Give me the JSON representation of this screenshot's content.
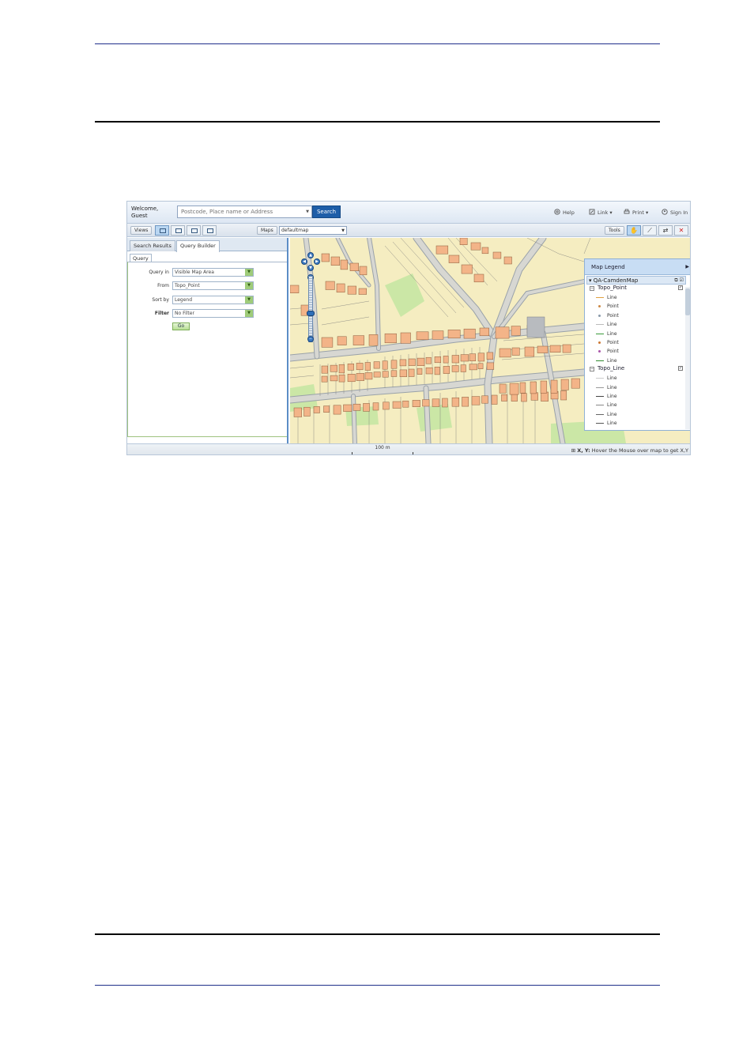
{
  "header": {
    "welcome_line1": "Welcome,",
    "welcome_line2": "Guest",
    "search_placeholder": "Postcode, Place name or Address",
    "search_button": "Search",
    "links": {
      "help": "Help",
      "link": "Link",
      "print": "Print",
      "sign_in": "Sign In"
    }
  },
  "toolbar": {
    "views_label": "Views",
    "maps_label": "Maps",
    "selected_map": "defaultmap",
    "tools_label": "Tools"
  },
  "panel": {
    "tabs": [
      "Search Results",
      "Query Builder"
    ],
    "active_tab": "Query Builder",
    "subtab": "Query",
    "fields": [
      {
        "label": "Query in",
        "value": "Visible Map Area"
      },
      {
        "label": "From",
        "value": "Topo_Point"
      },
      {
        "label": "Sort by",
        "value": "Legend"
      },
      {
        "label": "Filter",
        "value": "No Filter"
      }
    ],
    "go_button": "Go"
  },
  "legend": {
    "title": "Map Legend",
    "group": "QA-CamdenMap",
    "layers": [
      {
        "name": "Topo_Point",
        "items": [
          {
            "label": "Line",
            "kind": "line",
            "color": "#e0a040"
          },
          {
            "label": "Point",
            "kind": "point",
            "color": "#cc8844"
          },
          {
            "label": "Point",
            "kind": "point",
            "color": "#8899aa"
          },
          {
            "label": "Line",
            "kind": "line",
            "color": "#bbbbbb"
          },
          {
            "label": "Line",
            "kind": "line",
            "color": "#3a9a3a"
          },
          {
            "label": "Point",
            "kind": "point",
            "color": "#cc7733"
          },
          {
            "label": "Point",
            "kind": "point",
            "color": "#aa55aa"
          },
          {
            "label": "Line",
            "kind": "line",
            "color": "#2f8a2f"
          }
        ]
      },
      {
        "name": "Topo_Line",
        "items": [
          {
            "label": "Line",
            "kind": "line",
            "color": "#cccccc"
          },
          {
            "label": "Line",
            "kind": "line",
            "color": "#999999"
          },
          {
            "label": "Line",
            "kind": "line",
            "color": "#444444"
          },
          {
            "label": "Line",
            "kind": "line",
            "color": "#888888"
          },
          {
            "label": "Line",
            "kind": "line",
            "color": "#666666"
          },
          {
            "label": "Line",
            "kind": "line",
            "color": "#555555"
          }
        ]
      }
    ]
  },
  "status": {
    "scale": "100 m",
    "coord_label": "X, Y:",
    "coord_hint": "Hover the Mouse over map to get X,Y"
  },
  "colors": {
    "accent": "#1e5ea8",
    "building": "#f3b488",
    "land": "#f5edc1",
    "road": "#9aa2a9",
    "green": "#cbe7a6"
  }
}
